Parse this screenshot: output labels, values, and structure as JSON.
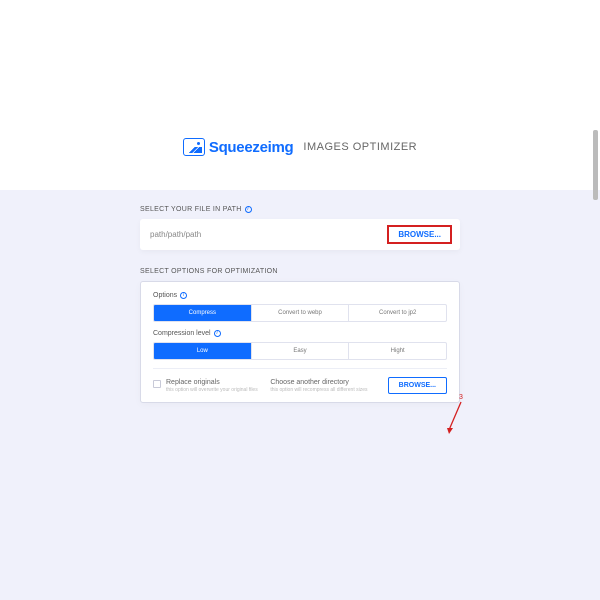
{
  "header": {
    "brand": "Squeezeimg",
    "subtitle": "IMAGES OPTIMIZER"
  },
  "filepath": {
    "label": "SELECT YOUR FILE IN PATH",
    "value": "path/path/path",
    "browse": "BROWSE..."
  },
  "options_label": "SELECT OPTIONS FOR OPTIMIZATION",
  "card": {
    "options_title": "Options",
    "opts": [
      "Compress",
      "Convert to webp",
      "Convert to jp2"
    ],
    "level_title": "Compression level",
    "levels": [
      "Low",
      "Easy",
      "Hight"
    ],
    "replace": {
      "title": "Replace originals",
      "sub": "this option will overwrite your original files"
    },
    "choose": {
      "title": "Choose another directory",
      "sub": "this option will recompress all different sizes"
    },
    "browse": "BROWSE..."
  },
  "annotation": {
    "number": "3"
  },
  "colors": {
    "primary": "#0f6cff",
    "annotation": "#d42020"
  }
}
